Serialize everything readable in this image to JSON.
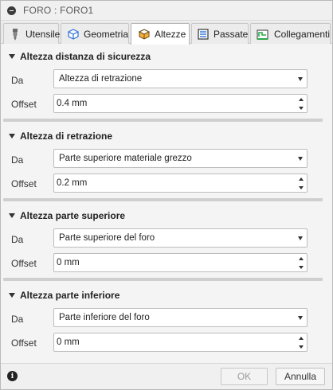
{
  "window": {
    "title": "FORO : FORO1"
  },
  "tabs": [
    {
      "label": "Utensile",
      "icon": "tool-icon",
      "active": false
    },
    {
      "label": "Geometria",
      "icon": "geometry-cube-icon",
      "active": false
    },
    {
      "label": "Altezze",
      "icon": "heights-box-icon",
      "active": true
    },
    {
      "label": "Passate",
      "icon": "passes-icon",
      "active": false
    },
    {
      "label": "Collegamenti",
      "icon": "linking-icon",
      "active": false
    }
  ],
  "sections": [
    {
      "title": "Altezza distanza di sicurezza",
      "from_label": "Da",
      "from_value": "Altezza di retrazione",
      "offset_label": "Offset",
      "offset_value": "0.4 mm"
    },
    {
      "title": "Altezza di retrazione",
      "from_label": "Da",
      "from_value": "Parte superiore materiale grezzo",
      "offset_label": "Offset",
      "offset_value": "0.2 mm"
    },
    {
      "title": "Altezza parte superiore",
      "from_label": "Da",
      "from_value": "Parte superiore del foro",
      "offset_label": "Offset",
      "offset_value": "0 mm"
    },
    {
      "title": "Altezza parte inferiore",
      "from_label": "Da",
      "from_value": "Parte inferiore del foro",
      "offset_label": "Offset",
      "offset_value": "0 mm"
    }
  ],
  "footer": {
    "info_icon": "info-icon",
    "ok_label": "OK",
    "cancel_label": "Annulla"
  }
}
